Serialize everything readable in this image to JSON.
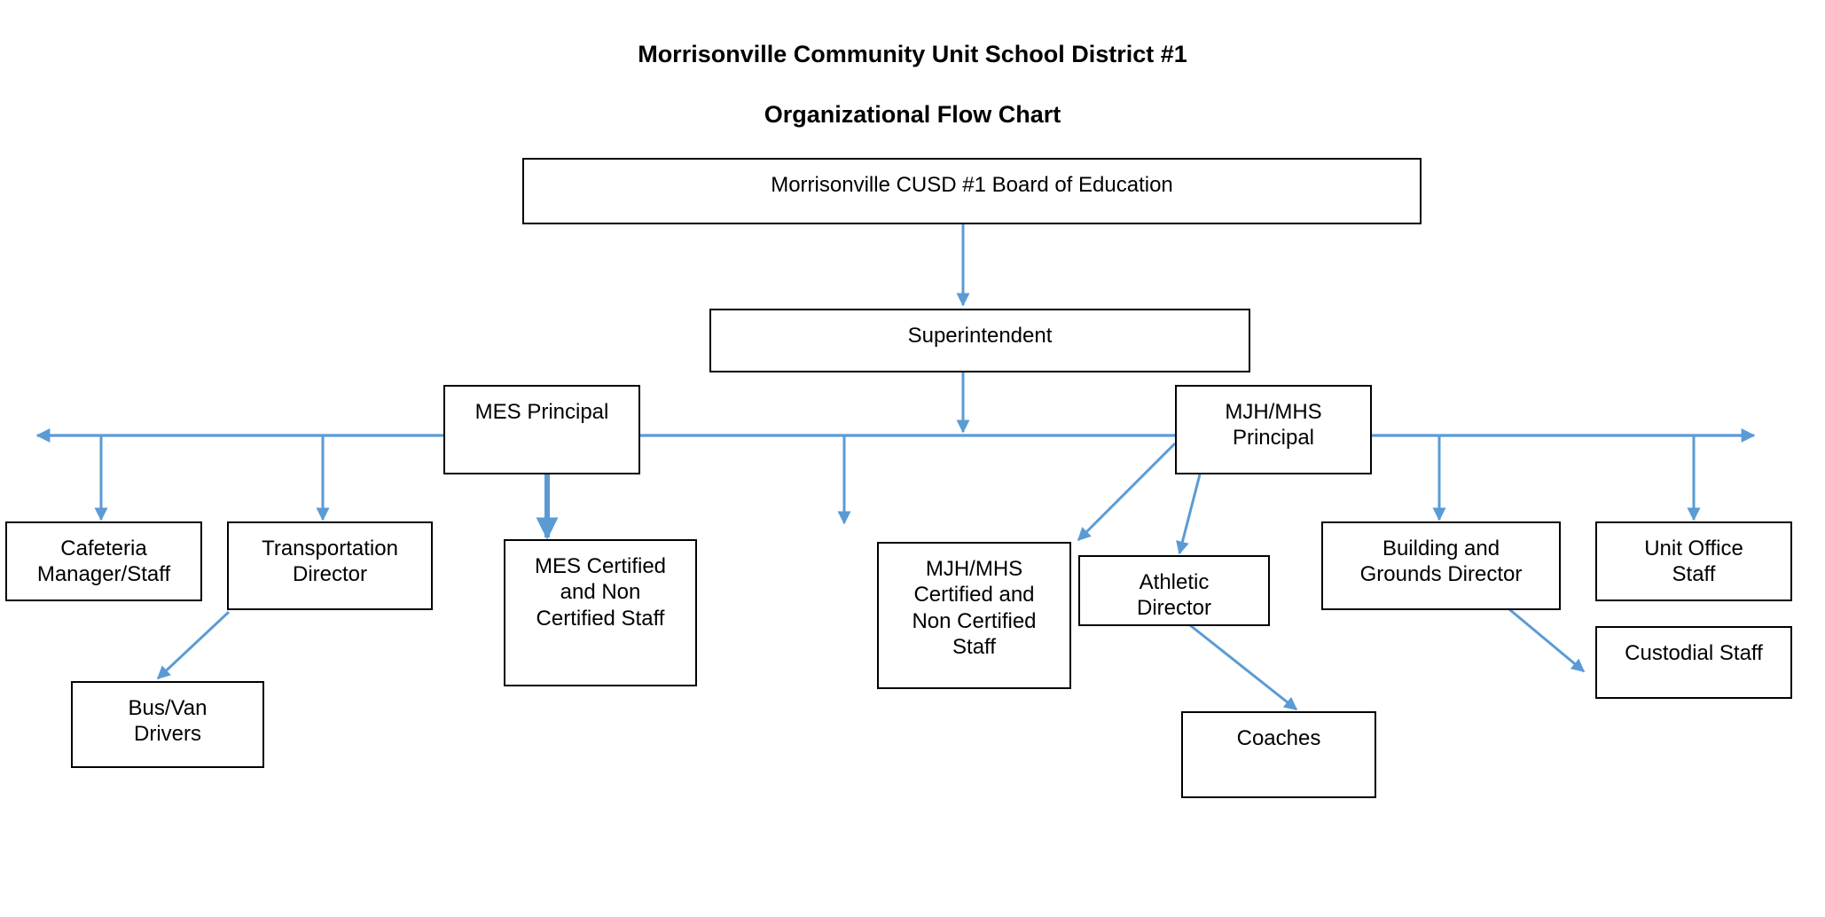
{
  "title": {
    "line1": "Morrisonville Community Unit School District #1",
    "line2": "Organizational Flow Chart"
  },
  "colors": {
    "connector": "#5B9BD5",
    "box_border": "#000000",
    "text": "#000000",
    "background": "#FFFFFF"
  },
  "chart_data": {
    "type": "diagram",
    "title": "Morrisonville Community Unit School District #1 Organizational Flow Chart",
    "nodes": [
      {
        "id": "board",
        "label": "Morrisonville CUSD #1 Board of Education"
      },
      {
        "id": "superintendent",
        "label": "Superintendent"
      },
      {
        "id": "mes_principal",
        "label": "MES Principal"
      },
      {
        "id": "mjh_principal",
        "label": "MJH/MHS\nPrincipal"
      },
      {
        "id": "cafeteria",
        "label": "Cafeteria\nManager/Staff"
      },
      {
        "id": "transportation",
        "label": "Transportation\nDirector"
      },
      {
        "id": "bus_drivers",
        "label": "Bus/Van\nDrivers"
      },
      {
        "id": "mes_staff",
        "label": "MES Certified\nand Non\nCertified Staff"
      },
      {
        "id": "mjh_staff",
        "label": "MJH/MHS\nCertified and\nNon Certified\nStaff"
      },
      {
        "id": "athletic",
        "label": "Athletic\nDirector"
      },
      {
        "id": "coaches",
        "label": "Coaches"
      },
      {
        "id": "buildings",
        "label": "Building and\nGrounds Director"
      },
      {
        "id": "unit_office",
        "label": "Unit Office\nStaff"
      },
      {
        "id": "custodial",
        "label": "Custodial Staff"
      }
    ],
    "edges": [
      {
        "from": "board",
        "to": "superintendent"
      },
      {
        "from": "superintendent",
        "to": "distribution-bus"
      },
      {
        "from": "distribution-bus",
        "to": "cafeteria"
      },
      {
        "from": "distribution-bus",
        "to": "transportation"
      },
      {
        "from": "distribution-bus",
        "to": "mjh_staff"
      },
      {
        "from": "distribution-bus",
        "to": "buildings"
      },
      {
        "from": "distribution-bus",
        "to": "unit_office"
      },
      {
        "from": "mes_principal",
        "to": "mes_staff"
      },
      {
        "from": "mjh_principal",
        "to": "mjh_staff"
      },
      {
        "from": "mjh_principal",
        "to": "athletic"
      },
      {
        "from": "transportation",
        "to": "bus_drivers"
      },
      {
        "from": "athletic",
        "to": "coaches"
      },
      {
        "from": "buildings",
        "to": "custodial"
      }
    ]
  }
}
